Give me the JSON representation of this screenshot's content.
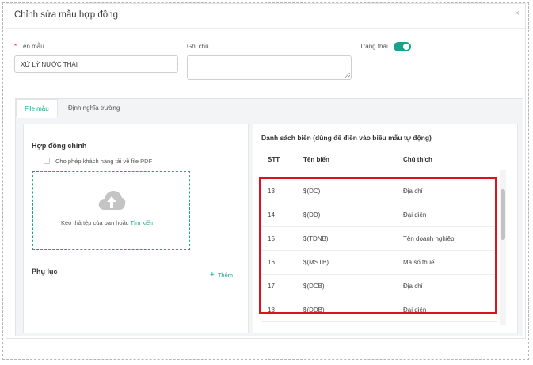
{
  "modal": {
    "title": "Chỉnh sửa mẫu hợp đồng",
    "close_glyph": "×"
  },
  "form": {
    "template_name": {
      "required_mark": "*",
      "label": "Tên mẫu",
      "value": "XỬ LÝ NƯỚC THẢI"
    },
    "note": {
      "label": "Ghi chú",
      "value": ""
    },
    "status": {
      "label": "Trạng thái",
      "enabled": true
    }
  },
  "tabs": [
    {
      "label": "File mẫu",
      "active": true
    },
    {
      "label": "Định nghĩa trường",
      "active": false
    }
  ],
  "left_panel": {
    "contract_title": "Hợp đồng chính",
    "allow_pdf_label": "Cho phép khách hàng tải về file PDF",
    "upload": {
      "icon": "cloud-upload-icon",
      "text": "Kéo thả tệp của bạn hoặc",
      "link": "Tìm kiếm"
    },
    "appendix_title": "Phụ lục",
    "add_label": "Thêm",
    "add_icon": "+"
  },
  "right_panel": {
    "title": "Danh sách biến (dùng để điền vào biểu mẫu tự động)",
    "columns": [
      "STT",
      "Tên biến",
      "Chú thích"
    ],
    "rows": [
      {
        "stt": "13",
        "name": "$(DC)",
        "note": "Địa chỉ"
      },
      {
        "stt": "14",
        "name": "$(DD)",
        "note": "Đại diện"
      },
      {
        "stt": "15",
        "name": "$(TDNB)",
        "note": "Tên doanh nghiệp"
      },
      {
        "stt": "16",
        "name": "$(MSTB)",
        "note": "Mã số thuế"
      },
      {
        "stt": "17",
        "name": "$(DCB)",
        "note": "Địa chỉ"
      },
      {
        "stt": "18",
        "name": "$(DDB)",
        "note": "Đại diện"
      }
    ]
  },
  "colors": {
    "accent": "#17a389",
    "highlight": "#d9141a"
  }
}
